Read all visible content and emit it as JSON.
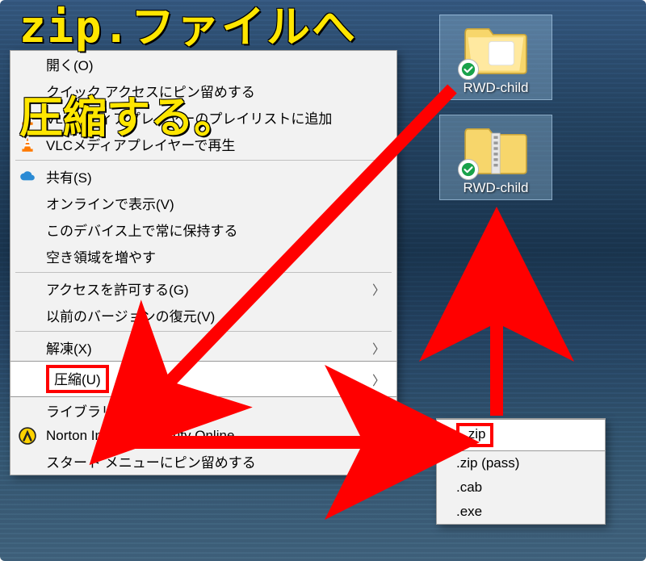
{
  "annotation": {
    "line1": "zip.ファイルへ",
    "line2": "圧縮する。"
  },
  "desktop_icons": {
    "folder": {
      "label": "RWD-child"
    },
    "zip": {
      "label": "RWD-child"
    }
  },
  "context_menu": {
    "open": "開く(O)",
    "pin_quick": "クイック アクセスにピン留めする",
    "vlc_playlist": "VLCメディアプレイヤーのプレイリストに追加",
    "vlc_play": "VLCメディアプレイヤーで再生",
    "share": "共有(S)",
    "view_online": "オンラインで表示(V)",
    "keep_device": "このデバイス上で常に保持する",
    "free_space": "空き領域を増やす",
    "give_access": "アクセスを許可する(G)",
    "restore_prev": "以前のバージョンの復元(V)",
    "extract": "解凍(X)",
    "compress": "圧縮(U)",
    "add_library": "ライブラリに追加(I)",
    "norton": "Norton Internet Security Online",
    "pin_start": "スタート メニューにピン留めする"
  },
  "submenu": {
    "zip": ".zip",
    "zip_pass": ".zip (pass)",
    "cab": ".cab",
    "exe": ".exe"
  },
  "colors": {
    "highlight_red": "#ff0000",
    "annot_yellow": "#ffe600"
  }
}
